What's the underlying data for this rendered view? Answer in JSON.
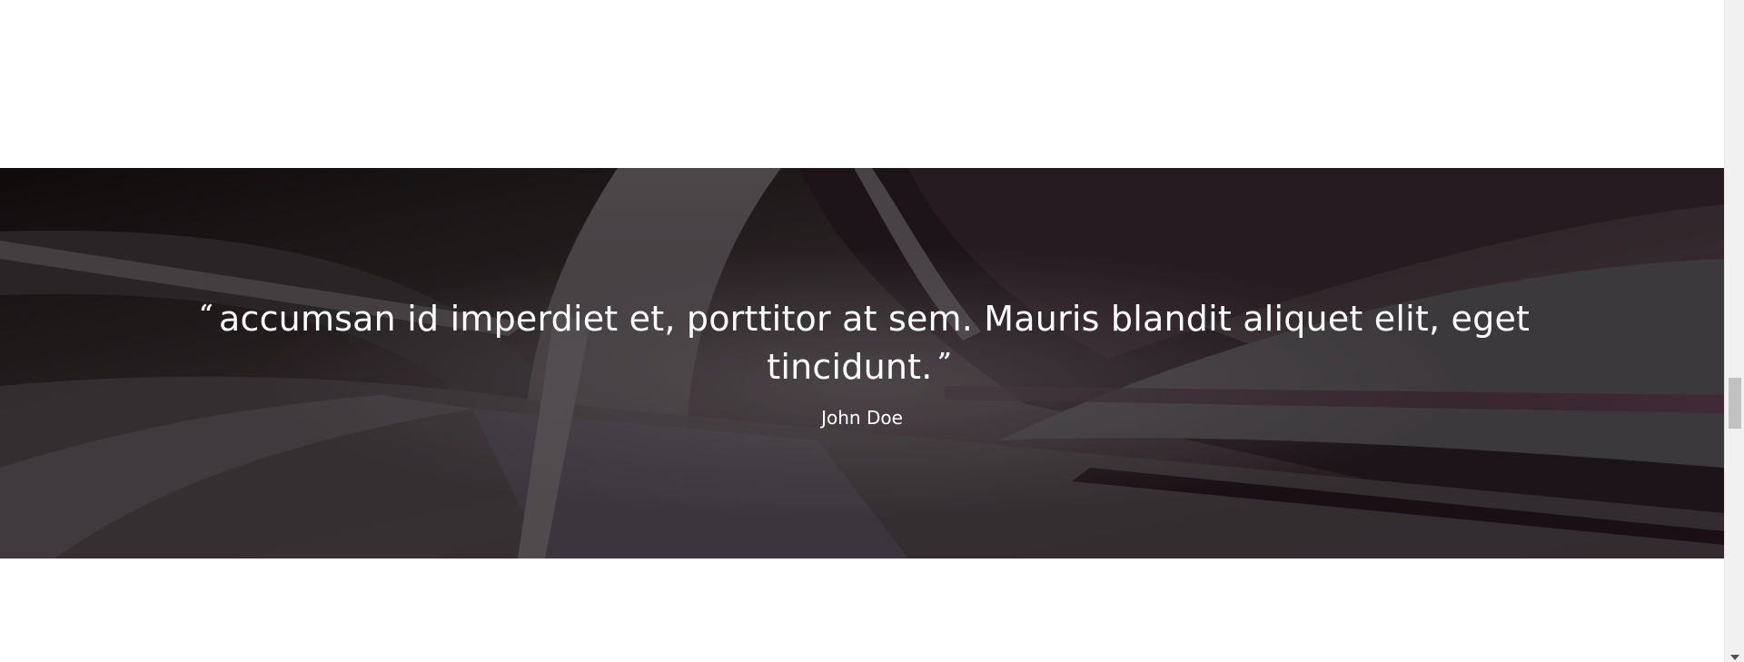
{
  "testimonial": {
    "open_quote": "“",
    "quote": "accumsan id imperdiet et, porttitor at sem. Mauris blandit aliquet elit, eget tincidunt.",
    "close_quote": "”",
    "author": "John Doe",
    "background_image": "abstract-curved-highway-render"
  },
  "colors": {
    "page_background": "#ffffff",
    "text": "#ffffff",
    "scrollbar_track": "#f1f1f1",
    "scrollbar_thumb": "#c1c1c1"
  },
  "icons": {
    "scroll_down": "scroll-down-arrow-icon"
  }
}
